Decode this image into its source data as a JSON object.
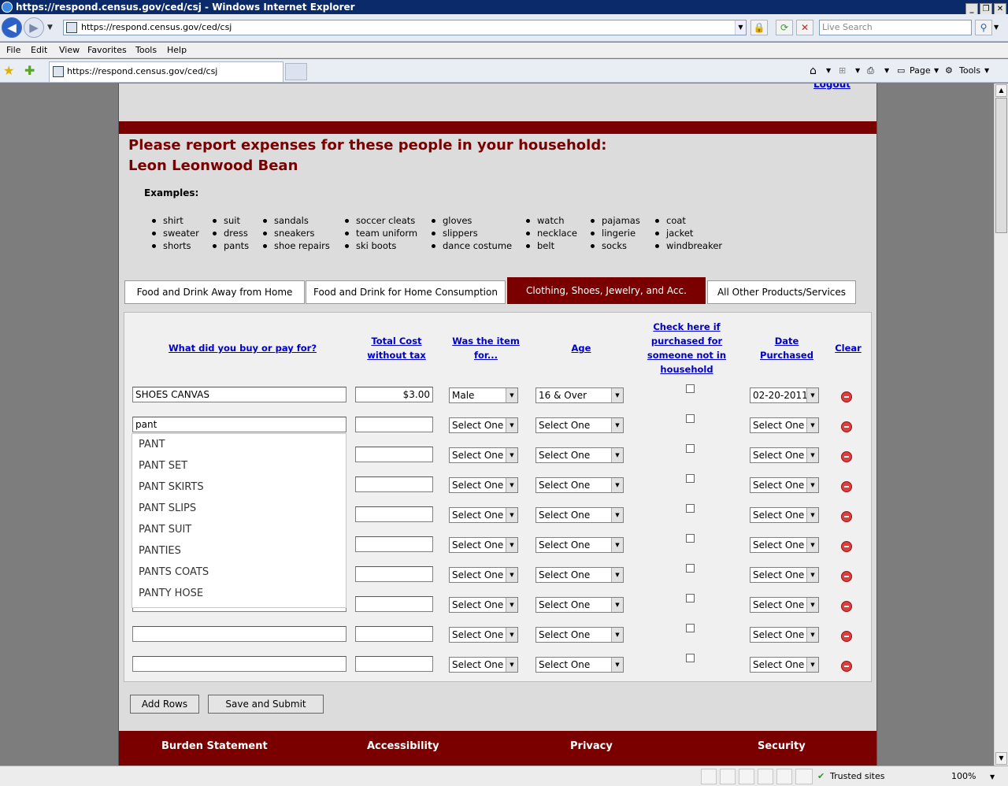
{
  "window": {
    "title": "https://respond.census.gov/ced/csj - Windows Internet Explorer"
  },
  "browser": {
    "url": "https://respond.census.gov/ced/csj",
    "search_placeholder": "Live Search",
    "tab_title": "https://respond.census.gov/ced/csj",
    "menu": [
      "File",
      "Edit",
      "View",
      "Favorites",
      "Tools",
      "Help"
    ],
    "cmd_page": "Page",
    "cmd_tools": "Tools",
    "status_zone": "Trusted sites",
    "zoom": "100%"
  },
  "page": {
    "logout": "Logout",
    "heading_line1": "Please report expenses for these people in your household:",
    "heading_line2": "Leon Leonwood Bean",
    "examples_label": "Examples:",
    "examples": [
      [
        "shirt",
        "sweater",
        "shorts"
      ],
      [
        "suit",
        "dress",
        "pants"
      ],
      [
        "sandals",
        "sneakers",
        "shoe repairs"
      ],
      [
        "soccer cleats",
        "team uniform",
        "ski boots"
      ],
      [
        "gloves",
        "slippers",
        "dance costume"
      ],
      [
        "watch",
        "necklace",
        "belt"
      ],
      [
        "pajamas",
        "lingerie",
        "socks"
      ],
      [
        "coat",
        "jacket",
        "windbreaker"
      ]
    ],
    "tabs": [
      {
        "label": "Food and Drink Away from Home"
      },
      {
        "label": "Food and Drink for Home Consumption"
      },
      {
        "label": "Clothing, Shoes, Jewelry, and Acc."
      },
      {
        "label": "All Other Products/Services"
      }
    ],
    "headers": {
      "what": "What did you buy or pay for?",
      "cost_l1": "Total Cost",
      "cost_l2": "without tax",
      "for_l1": "Was the item",
      "for_l2": "for...",
      "age": "Age",
      "check_l1": "Check here if",
      "check_l2": "purchased for",
      "check_l3": "someone not in",
      "check_l4": "household",
      "date_l1": "Date",
      "date_l2": "Purchased",
      "clear": "Clear"
    },
    "rows": [
      {
        "item": "SHOES CANVAS",
        "cost": "$3.00",
        "for": "Male",
        "age": "16 & Over",
        "date": "02-20-2011"
      },
      {
        "item": "pant",
        "cost": "",
        "for": "Select One",
        "age": "Select One",
        "date": "Select One"
      },
      {
        "item": "",
        "cost": "",
        "for": "Select One",
        "age": "Select One",
        "date": "Select One"
      },
      {
        "item": "",
        "cost": "",
        "for": "Select One",
        "age": "Select One",
        "date": "Select One"
      },
      {
        "item": "",
        "cost": "",
        "for": "Select One",
        "age": "Select One",
        "date": "Select One"
      },
      {
        "item": "",
        "cost": "",
        "for": "Select One",
        "age": "Select One",
        "date": "Select One"
      },
      {
        "item": "",
        "cost": "",
        "for": "Select One",
        "age": "Select One",
        "date": "Select One"
      },
      {
        "item": "",
        "cost": "",
        "for": "Select One",
        "age": "Select One",
        "date": "Select One"
      },
      {
        "item": "",
        "cost": "",
        "for": "Select One",
        "age": "Select One",
        "date": "Select One"
      },
      {
        "item": "",
        "cost": "",
        "for": "Select One",
        "age": "Select One",
        "date": "Select One"
      }
    ],
    "autocomplete": [
      "PANT",
      "PANT SET",
      "PANT SKIRTS",
      "PANT SLIPS",
      "PANT SUIT",
      "PANTIES",
      "PANTS COATS",
      "PANTY HOSE"
    ],
    "buttons": {
      "add_rows": "Add Rows",
      "save_submit": "Save and Submit"
    },
    "footer": [
      "Burden Statement",
      "Accessibility",
      "Privacy",
      "Security"
    ]
  }
}
